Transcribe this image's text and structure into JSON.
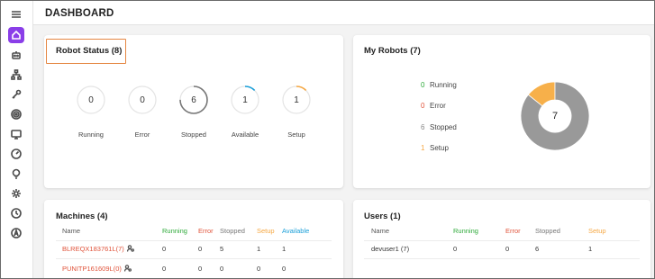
{
  "header": {
    "title": "DASHBOARD"
  },
  "sidebar": {
    "items": [
      {
        "name": "menu-icon"
      },
      {
        "name": "home-icon",
        "active": true
      },
      {
        "name": "robot-icon"
      },
      {
        "name": "hierarchy-icon"
      },
      {
        "name": "key-icon"
      },
      {
        "name": "target-icon"
      },
      {
        "name": "monitor-icon"
      },
      {
        "name": "gauge-icon"
      },
      {
        "name": "lightbulb-icon"
      },
      {
        "name": "gear-icon"
      },
      {
        "name": "clock-icon"
      },
      {
        "name": "accessibility-icon"
      }
    ]
  },
  "robot_status": {
    "title": "Robot Status (8)",
    "items": [
      {
        "label": "Running",
        "value": "0",
        "fraction": 0,
        "color": "#2eaa3a"
      },
      {
        "label": "Error",
        "value": "0",
        "fraction": 0,
        "color": "#e0533a"
      },
      {
        "label": "Stopped",
        "value": "6",
        "fraction": 0.75,
        "color": "#777777"
      },
      {
        "label": "Available",
        "value": "1",
        "fraction": 0.125,
        "color": "#1a9fd8"
      },
      {
        "label": "Setup",
        "value": "1",
        "fraction": 0.125,
        "color": "#f5a742"
      }
    ]
  },
  "my_robots": {
    "title": "My Robots (7)",
    "total": "7",
    "legend": [
      {
        "value": "0",
        "label": "Running",
        "color": "#2eaa3a"
      },
      {
        "value": "0",
        "label": "Error",
        "color": "#e0533a"
      },
      {
        "value": "6",
        "label": "Stopped",
        "color": "#888888"
      },
      {
        "value": "1",
        "label": "Setup",
        "color": "#f5a742"
      }
    ],
    "slices": [
      {
        "label": "Stopped",
        "value": 6,
        "color": "#999999"
      },
      {
        "label": "Setup",
        "value": 1,
        "color": "#f7b04a"
      }
    ]
  },
  "machines": {
    "title": "Machines (4)",
    "columns": [
      {
        "label": "Name",
        "color": "#555555"
      },
      {
        "label": "Running",
        "color": "#2eaa3a"
      },
      {
        "label": "Error",
        "color": "#e0533a"
      },
      {
        "label": "Stopped",
        "color": "#777777"
      },
      {
        "label": "Setup",
        "color": "#f5a742"
      },
      {
        "label": "Available",
        "color": "#1a9fd8"
      }
    ],
    "rows": [
      {
        "name": "BLREQX183761L(7)",
        "running": "0",
        "error": "0",
        "stopped": "5",
        "setup": "1",
        "available": "1"
      },
      {
        "name": "PUNITP161609L(0)",
        "running": "0",
        "error": "0",
        "stopped": "0",
        "setup": "0",
        "available": "0"
      }
    ]
  },
  "users": {
    "title": "Users (1)",
    "columns": [
      {
        "label": "Name",
        "color": "#555555"
      },
      {
        "label": "Running",
        "color": "#2eaa3a"
      },
      {
        "label": "Error",
        "color": "#e0533a"
      },
      {
        "label": "Stopped",
        "color": "#777777"
      },
      {
        "label": "Setup",
        "color": "#f5a742"
      }
    ],
    "rows": [
      {
        "name": "devuser1 (7)",
        "running": "0",
        "error": "0",
        "stopped": "6",
        "setup": "1"
      }
    ]
  }
}
